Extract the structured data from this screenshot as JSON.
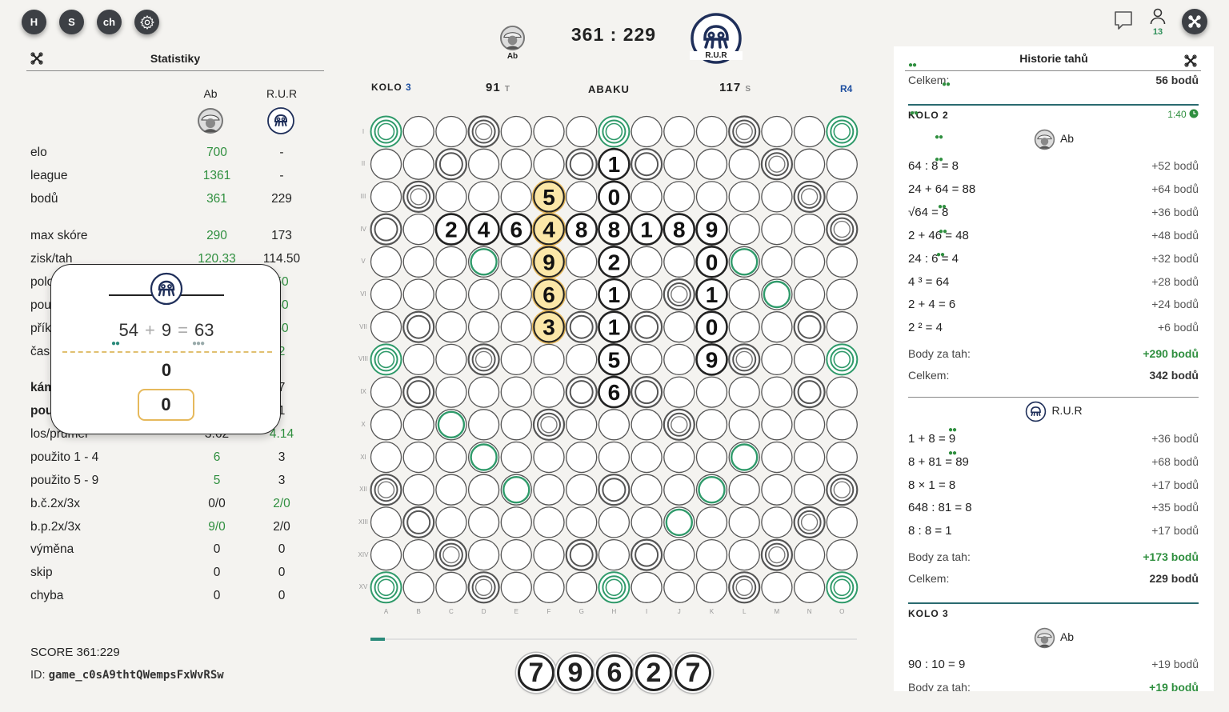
{
  "top_buttons": [
    "H",
    "S",
    "ch"
  ],
  "online_count": "13",
  "header": {
    "player1": "Ab",
    "player2": "R.U.R",
    "score_left": "361",
    "score_sep": ":",
    "score_right": "229"
  },
  "board_header": {
    "kolo_label": "KOLO",
    "kolo_num": "3",
    "left_points": "91",
    "left_suffix": "T",
    "brand": "ABAKU",
    "right_points": "117",
    "right_suffix": "S",
    "round": "R4"
  },
  "stats": {
    "title": "Statistiky",
    "col1": "Ab",
    "col2": "R.U.R",
    "rows": [
      {
        "label": "elo",
        "v1": "700",
        "v2": "-"
      },
      {
        "label": "league",
        "v1": "1361",
        "v2": "-"
      },
      {
        "label": "bodů",
        "v1": "361",
        "v2": "229"
      },
      {
        "label": "max skóre",
        "v1": "290",
        "v2": "173"
      },
      {
        "label": "zisk/tah",
        "v1": "120.33",
        "v2": "114.50"
      },
      {
        "label": "polo",
        "v1": "",
        "v2": "50"
      },
      {
        "label": "pou",
        "v1": "",
        "v2": "50"
      },
      {
        "label": "přík",
        "v1": "",
        "v2": "50"
      },
      {
        "label": "čas",
        "v1": "",
        "v2": "2"
      },
      {
        "label": "kám",
        "v1": "",
        "v2": "7"
      },
      {
        "label": "pou",
        "v1": "",
        "v2": "1"
      },
      {
        "label": "los/průměr",
        "v1": "3.62",
        "v2": "4.14"
      },
      {
        "label": "použito 1 - 4",
        "v1": "6",
        "v2": "3"
      },
      {
        "label": "použito 5 - 9",
        "v1": "5",
        "v2": "3"
      },
      {
        "label": "b.č.2x/3x",
        "v1": "0/0",
        "v2": "2/0"
      },
      {
        "label": "b.p.2x/3x",
        "v1": "9/0",
        "v2": "2/0"
      },
      {
        "label": "výměna",
        "v1": "0",
        "v2": "0"
      },
      {
        "label": "skip",
        "v1": "0",
        "v2": "0"
      },
      {
        "label": "chyba",
        "v1": "0",
        "v2": "0"
      }
    ],
    "score_line": "SCORE 361:229",
    "id_label": "ID:",
    "id_value": "game_c0sA9thtQWempsFxWvRSw"
  },
  "popup": {
    "a": "54",
    "op": "+",
    "b": "9",
    "eq": "=",
    "c": "63",
    "result": "0",
    "input_value": "0"
  },
  "board": {
    "row_labels": [
      "I",
      "II",
      "III",
      "IV",
      "V",
      "VI",
      "VII",
      "VIII",
      "IX",
      "X",
      "XI",
      "XII",
      "XIII",
      "XIV",
      "XV"
    ],
    "col_labels": [
      "A",
      "B",
      "C",
      "D",
      "E",
      "F",
      "G",
      "H",
      "I",
      "J",
      "K",
      "L",
      "M",
      "N",
      "O"
    ],
    "placed_tiles": [
      {
        "row": 2,
        "col": 8,
        "val": "1"
      },
      {
        "row": 3,
        "col": 6,
        "val": "5",
        "new": true
      },
      {
        "row": 3,
        "col": 8,
        "val": "0"
      },
      {
        "row": 4,
        "col": 3,
        "val": "2"
      },
      {
        "row": 4,
        "col": 4,
        "val": "4"
      },
      {
        "row": 4,
        "col": 5,
        "val": "6"
      },
      {
        "row": 4,
        "col": 6,
        "val": "4",
        "new": true
      },
      {
        "row": 4,
        "col": 7,
        "val": "8"
      },
      {
        "row": 4,
        "col": 8,
        "val": "8"
      },
      {
        "row": 4,
        "col": 9,
        "val": "1"
      },
      {
        "row": 4,
        "col": 10,
        "val": "8"
      },
      {
        "row": 4,
        "col": 11,
        "val": "9"
      },
      {
        "row": 5,
        "col": 6,
        "val": "9",
        "new": true
      },
      {
        "row": 5,
        "col": 8,
        "val": "2"
      },
      {
        "row": 5,
        "col": 11,
        "val": "0"
      },
      {
        "row": 6,
        "col": 6,
        "val": "6",
        "new": true
      },
      {
        "row": 6,
        "col": 8,
        "val": "1"
      },
      {
        "row": 6,
        "col": 11,
        "val": "1"
      },
      {
        "row": 7,
        "col": 6,
        "val": "3",
        "new": true
      },
      {
        "row": 7,
        "col": 8,
        "val": "1"
      },
      {
        "row": 7,
        "col": 11,
        "val": "0"
      },
      {
        "row": 8,
        "col": 8,
        "val": "5"
      },
      {
        "row": 8,
        "col": 11,
        "val": "9"
      },
      {
        "row": 9,
        "col": 8,
        "val": "6"
      }
    ],
    "bonus_cells": {
      "triple_green": [
        [
          1,
          1
        ],
        [
          1,
          8
        ],
        [
          1,
          15
        ],
        [
          8,
          1
        ],
        [
          8,
          15
        ],
        [
          15,
          1
        ],
        [
          15,
          8
        ],
        [
          15,
          15
        ]
      ],
      "single_green": [
        [
          5,
          4
        ],
        [
          5,
          12
        ],
        [
          6,
          13
        ],
        [
          10,
          3
        ],
        [
          11,
          4
        ],
        [
          11,
          12
        ],
        [
          12,
          5
        ],
        [
          12,
          11
        ],
        [
          13,
          10
        ]
      ],
      "double_gray": [
        [
          1,
          4
        ],
        [
          1,
          12
        ],
        [
          2,
          3
        ],
        [
          2,
          7
        ],
        [
          2,
          9
        ],
        [
          2,
          13
        ],
        [
          3,
          2
        ],
        [
          3,
          14
        ],
        [
          4,
          1
        ],
        [
          4,
          15
        ],
        [
          6,
          10
        ],
        [
          7,
          2
        ],
        [
          7,
          7
        ],
        [
          7,
          9
        ],
        [
          7,
          14
        ],
        [
          8,
          4
        ],
        [
          8,
          12
        ],
        [
          9,
          2
        ],
        [
          9,
          7
        ],
        [
          9,
          9
        ],
        [
          9,
          14
        ],
        [
          10,
          6
        ],
        [
          10,
          10
        ],
        [
          12,
          1
        ],
        [
          12,
          8
        ],
        [
          12,
          15
        ],
        [
          13,
          2
        ],
        [
          13,
          14
        ],
        [
          14,
          3
        ],
        [
          14,
          7
        ],
        [
          14,
          9
        ],
        [
          14,
          13
        ],
        [
          15,
          4
        ],
        [
          15,
          12
        ]
      ],
      "double_ring": [
        [
          1,
          4
        ],
        [
          1,
          12
        ],
        [
          2,
          13
        ],
        [
          3,
          2
        ],
        [
          3,
          14
        ],
        [
          4,
          15
        ],
        [
          6,
          10
        ],
        [
          8,
          4
        ],
        [
          8,
          12
        ],
        [
          10,
          6
        ],
        [
          10,
          10
        ],
        [
          12,
          1
        ],
        [
          12,
          15
        ],
        [
          13,
          14
        ],
        [
          14,
          3
        ],
        [
          14,
          13
        ],
        [
          15,
          4
        ],
        [
          15,
          12
        ]
      ]
    }
  },
  "progress": 0.03,
  "rack": [
    "7",
    "9",
    "6",
    "2",
    "7"
  ],
  "history": {
    "title": "Historie tahů",
    "total_label": "Celkem:",
    "first_total": "56 bodů",
    "kolo2": {
      "label": "KOLO 2",
      "time": "1:40"
    },
    "ab_name": "Ab",
    "ab_moves": [
      {
        "expr": "64 : 8 = 8",
        "pts": "+52 bodů"
      },
      {
        "expr": "24 + 64 = 88",
        "pts": "+64 bodů"
      },
      {
        "expr": "√64 = 8",
        "pts": "+36 bodů"
      },
      {
        "expr": "2 + 46 = 48",
        "pts": "+48 bodů"
      },
      {
        "expr": "24 : 6 = 4",
        "pts": "+32 bodů"
      },
      {
        "expr": "4 ³ = 64",
        "pts": "+28 bodů"
      },
      {
        "expr": "2 + 4 = 6",
        "pts": "+24 bodů"
      },
      {
        "expr": "2 ² = 4",
        "pts": "+6 bodů"
      }
    ],
    "turn_label": "Body za tah:",
    "ab_turn": "+290 bodů",
    "ab_total": "342 bodů",
    "rur_name": "R.U.R",
    "rur_moves": [
      {
        "expr": "1 + 8 = 9",
        "pts": "+36 bodů"
      },
      {
        "expr": "8 + 81 = 89",
        "pts": "+68 bodů"
      },
      {
        "expr": "8 × 1 = 8",
        "pts": "+17 bodů"
      },
      {
        "expr": "648 : 81 = 8",
        "pts": "+35 bodů"
      },
      {
        "expr": "8 : 8 = 1",
        "pts": "+17 bodů"
      }
    ],
    "rur_turn": "+173 bodů",
    "rur_total": "229 bodů",
    "kolo3": {
      "label": "KOLO 3"
    },
    "ab3_moves": [
      {
        "expr": "90 : 10 = 9",
        "pts": "+19 bodů"
      }
    ],
    "ab3_turn": "+19 bodů"
  }
}
